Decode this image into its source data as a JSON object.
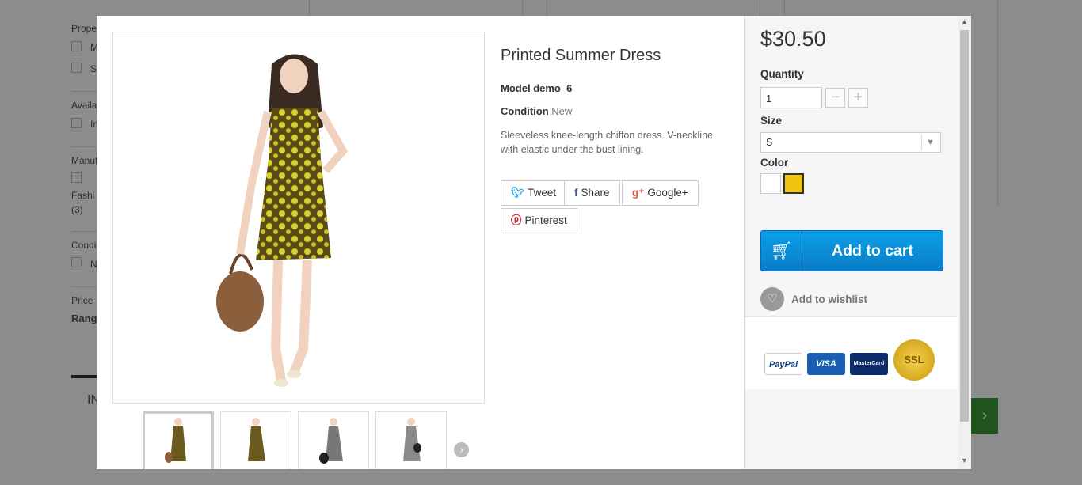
{
  "background": {
    "sidebar_labels": [
      "Prope",
      "M",
      "S",
      "Availa",
      "In",
      "Manuf",
      "Fashi",
      "(3)",
      "Condi",
      "N",
      "Price",
      "Rang",
      "IN"
    ],
    "next_button_icon": "chevron-right-icon"
  },
  "product": {
    "title": "Printed Summer Dress",
    "model_label": "Model",
    "model_value": "demo_6",
    "condition_label": "Condition",
    "condition_value": "New",
    "description": "Sleeveless knee-length chiffon dress. V-neckline with elastic under the bust lining.",
    "thumbnail_count": 4,
    "selected_thumbnail": 1
  },
  "social": {
    "tweet": "Tweet",
    "share": "Share",
    "google": "Google+",
    "pinterest": "Pinterest"
  },
  "purchase": {
    "price": "$30.50",
    "quantity_label": "Quantity",
    "quantity_value": "1",
    "size_label": "Size",
    "size_value": "S",
    "color_label": "Color",
    "colors": [
      "#ffffff",
      "#f1c40f"
    ],
    "selected_color": "#f1c40f",
    "add_to_cart": "Add to cart",
    "add_to_wishlist": "Add to wishlist"
  },
  "payment": {
    "paypal": "PayPal",
    "visa": "VISA",
    "mastercard": "MasterCard",
    "ssl": "SSL"
  },
  "colors": {
    "cart_button": "#0b8fd8",
    "accent_yellow": "#f1c40f"
  }
}
